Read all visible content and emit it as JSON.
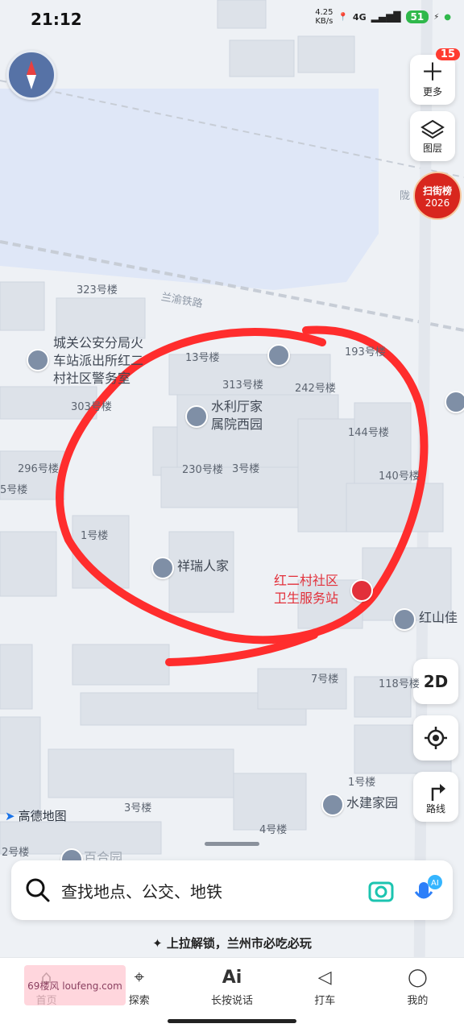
{
  "status": {
    "time": "21:12",
    "net_speed_value": "4.25",
    "net_speed_unit": "KB/s",
    "network": "4G",
    "battery": "51"
  },
  "controls": {
    "more_label": "更多",
    "more_badge": "15",
    "layers_label": "图层",
    "jiepai_title": "扫街榜",
    "jiepai_year": "2026",
    "mode_2d": "2D",
    "route_label": "路线"
  },
  "brand": {
    "name": "高德地图"
  },
  "map_labels": {
    "rail": "兰渝铁路",
    "rail_end": "陇",
    "b323": "323号楼",
    "b303": "303号楼",
    "b296": "296号楼",
    "b5": "5号楼",
    "b313": "313号楼",
    "b242": "242号楼",
    "b193": "193号楼",
    "b13": "13号楼",
    "b144": "144号楼",
    "b140": "140号楼",
    "b230": "230号楼",
    "b3": "3号楼",
    "b1": "1号楼",
    "b7": "7号楼",
    "b118": "118号楼",
    "b1b": "1号楼",
    "b3b": "3号楼",
    "b4": "4号楼",
    "b2": "2号楼"
  },
  "pois": {
    "police": [
      "城关公安分局火",
      "车站派出所红二",
      "村社区警务室"
    ],
    "shuili": [
      "水利厅家",
      "属院西园"
    ],
    "xiangrui": "祥瑞人家",
    "clinic": [
      "红二村社区",
      "卫生服务站"
    ],
    "hongshan": "红山佳",
    "shuijian": "水建家园",
    "baihe": "百合园"
  },
  "search": {
    "placeholder": "查找地点、公交、地铁"
  },
  "promo": "上拉解锁，兰州市必吃必玩",
  "nav": [
    {
      "label": "首页"
    },
    {
      "label": "探索"
    },
    {
      "label": "长按说话"
    },
    {
      "label": "打车"
    },
    {
      "label": "我的"
    }
  ],
  "watermark": "69楼风 loufeng.com",
  "colors": {
    "accent": "#2fb84b",
    "annotation": "#ff2d2d",
    "water": "#dfe7f7",
    "building": "#dde2e9"
  }
}
